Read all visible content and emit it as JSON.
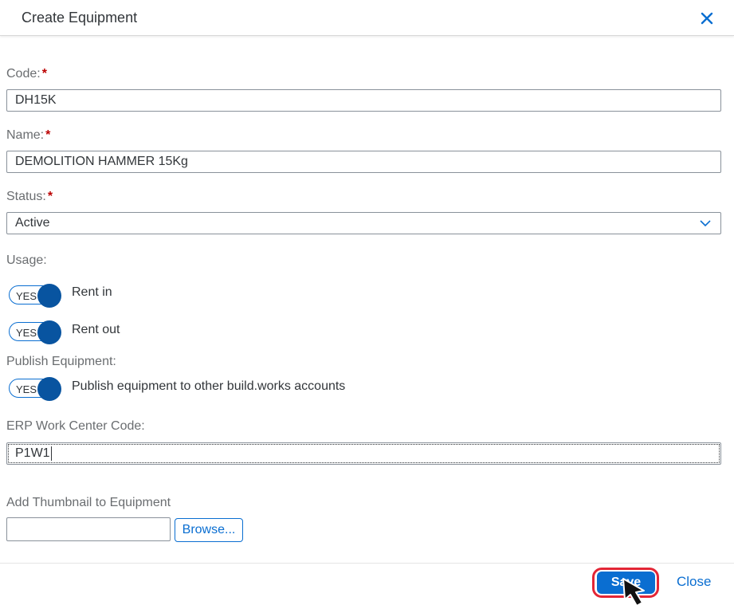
{
  "dialog": {
    "title": "Create Equipment",
    "close_icon": "close-icon"
  },
  "form": {
    "code": {
      "label": "Code:",
      "required_mark": "*",
      "value": "DH15K"
    },
    "name": {
      "label": "Name:",
      "required_mark": "*",
      "value": "DEMOLITION HAMMER 15Kg"
    },
    "status": {
      "label": "Status:",
      "required_mark": "*",
      "value": "Active",
      "icon": "chevron-down-icon"
    },
    "usage": {
      "label": "Usage:",
      "rent_in": {
        "state": "YES",
        "label": "Rent in"
      },
      "rent_out": {
        "state": "YES",
        "label": "Rent out"
      }
    },
    "publish": {
      "label": "Publish Equipment:",
      "toggle": {
        "state": "YES",
        "label": "Publish equipment to other build.works accounts"
      }
    },
    "erp": {
      "label": "ERP Work Center Code:",
      "value": "P1W1"
    },
    "thumbnail": {
      "label": "Add Thumbnail to Equipment",
      "browse_label": "Browse..."
    }
  },
  "footer": {
    "save_label": "Save",
    "close_label": "Close"
  },
  "colors": {
    "accent": "#0a6ed1",
    "toggle_knob": "#0854a0",
    "required": "#bb0000",
    "highlight_ring": "#e32636"
  }
}
